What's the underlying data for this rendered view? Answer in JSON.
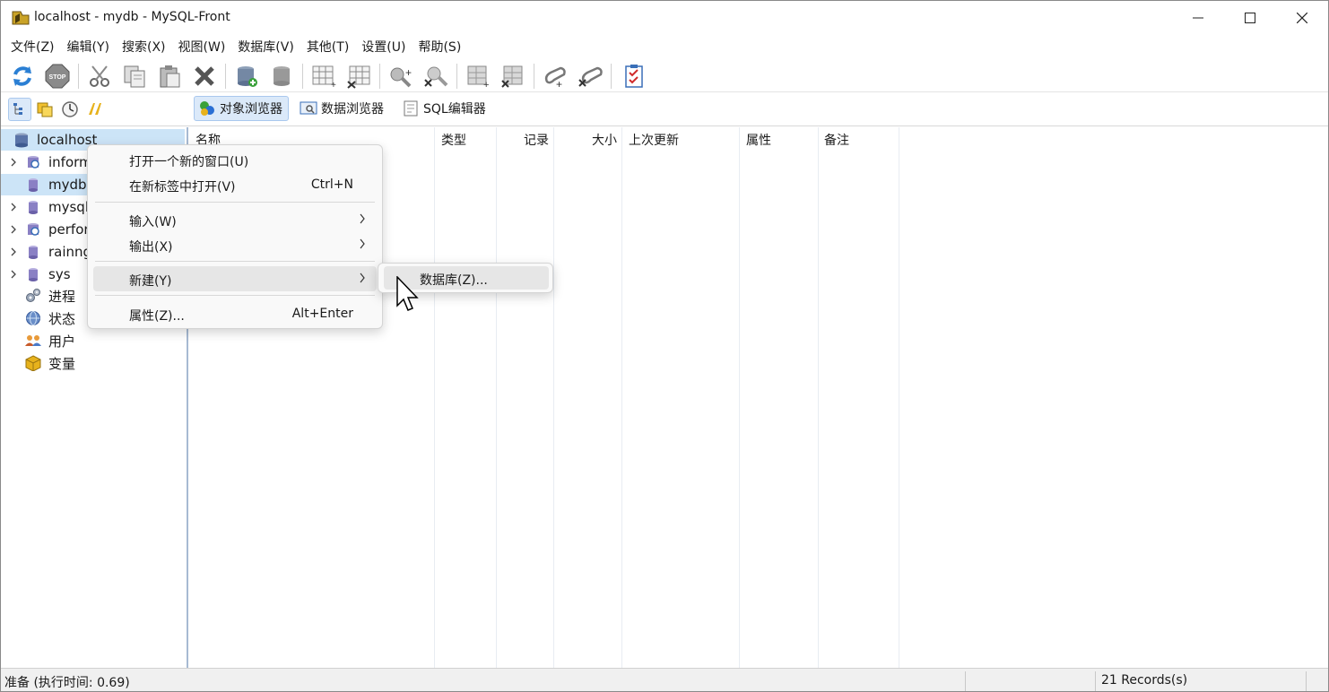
{
  "window": {
    "title": "localhost - mydb - MySQL-Front"
  },
  "menu": [
    "文件(Z)",
    "编辑(Y)",
    "搜索(X)",
    "视图(W)",
    "数据库(V)",
    "其他(T)",
    "设置(U)",
    "帮助(S)"
  ],
  "toolbar_icons": [
    "refresh-icon",
    "stop-icon",
    "cut-icon",
    "copy-icon",
    "paste-icon",
    "delete-icon",
    "add-database-icon",
    "remove-database-icon",
    "add-table-icon",
    "remove-table-icon",
    "add-field-icon",
    "remove-field-icon",
    "add-index-icon",
    "remove-index-icon",
    "add-key-icon",
    "remove-key-icon",
    "check-icon"
  ],
  "view_tabs": [
    {
      "label": "对象浏览器",
      "active": true
    },
    {
      "label": "数据浏览器",
      "active": false
    },
    {
      "label": "SQL编辑器",
      "active": false
    }
  ],
  "tree": {
    "root": "localhost",
    "items": [
      {
        "label": "inform",
        "expandable": true,
        "selected": false
      },
      {
        "label": "mydb",
        "expandable": false,
        "selected": true
      },
      {
        "label": "mysql",
        "expandable": true,
        "selected": false
      },
      {
        "label": "perfor",
        "expandable": true,
        "selected": false
      },
      {
        "label": "rainng",
        "expandable": true,
        "selected": false
      },
      {
        "label": "sys",
        "expandable": true,
        "selected": false
      },
      {
        "label": "进程",
        "expandable": false,
        "selected": false
      },
      {
        "label": "状态",
        "expandable": false,
        "selected": false
      },
      {
        "label": "用户",
        "expandable": false,
        "selected": false
      },
      {
        "label": "变量",
        "expandable": false,
        "selected": false
      }
    ]
  },
  "list": {
    "columns": [
      "名称",
      "类型",
      "记录",
      "大小",
      "上次更新",
      "属性",
      "备注"
    ]
  },
  "context_menu": {
    "items": [
      {
        "label": "打开一个新的窗口(U)",
        "shortcut": ""
      },
      {
        "label": "在新标签中打开(V)",
        "shortcut": "Ctrl+N"
      },
      {
        "label": "输入(W)",
        "shortcut": ""
      },
      {
        "label": "输出(X)",
        "shortcut": ""
      },
      {
        "label": "新建(Y)",
        "shortcut": ""
      },
      {
        "label": "属性(Z)...",
        "shortcut": "Alt+Enter"
      }
    ],
    "submenu": {
      "label": "数据库(Z)..."
    }
  },
  "status": {
    "left": "准备  (执行时间: 0.69)",
    "right": "21 Records(s)"
  }
}
